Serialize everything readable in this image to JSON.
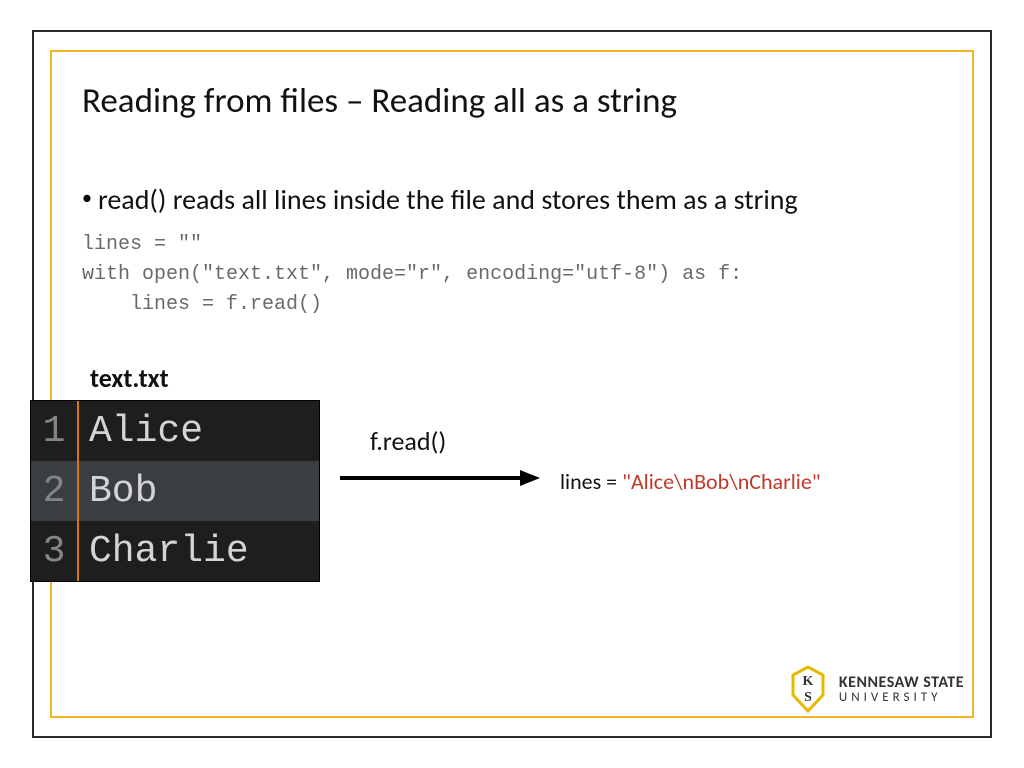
{
  "title": "Reading from files – Reading all as a string",
  "bullet": "read() reads all lines inside the file and stores them as a string",
  "code": {
    "line1": "lines = \"\"",
    "line2": "with open(\"text.txt\", mode=\"r\", encoding=\"utf-8\") as f:",
    "line3": "    lines = f.read()"
  },
  "fileLabel": "text.txt",
  "editor": {
    "rows": [
      {
        "num": "1",
        "text": "Alice"
      },
      {
        "num": "2",
        "text": "Bob"
      },
      {
        "num": "3",
        "text": "Charlie"
      }
    ]
  },
  "arrowLabel": "f.read()",
  "result": {
    "prefix": "lines = ",
    "value": "\"Alice\\nBob\\nCharlie\""
  },
  "logo": {
    "line1": "KENNESAW STATE",
    "line2": "UNIVERSITY"
  }
}
